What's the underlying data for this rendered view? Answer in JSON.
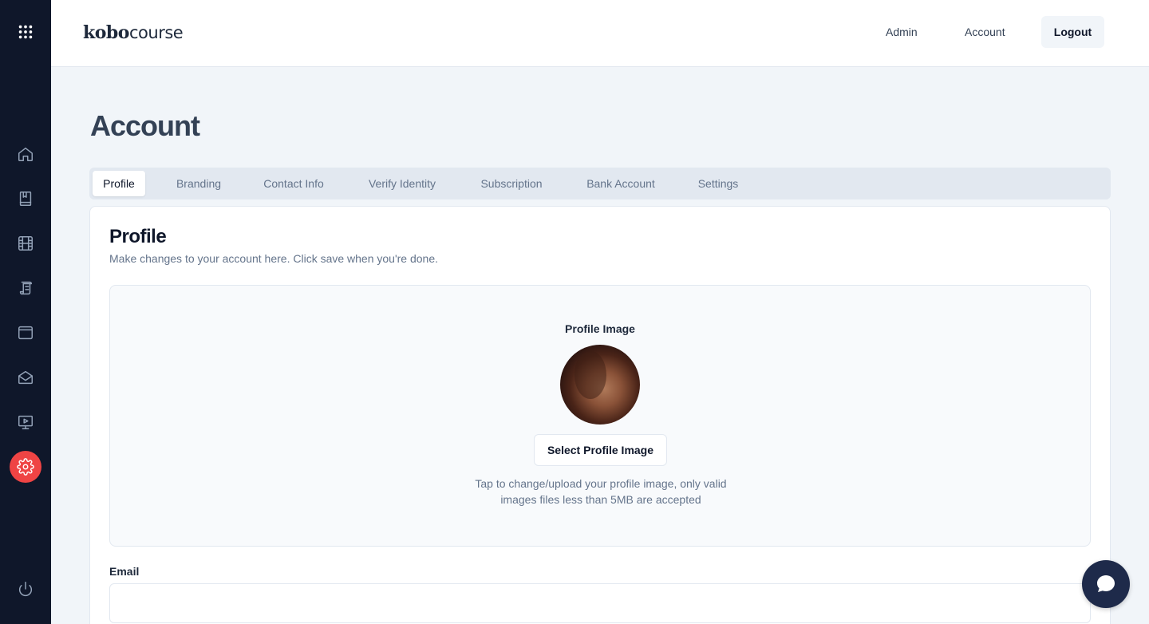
{
  "brand": {
    "logo_bold": "kobo",
    "logo_light": "course"
  },
  "topnav": {
    "admin": "Admin",
    "account": "Account",
    "logout": "Logout"
  },
  "sidebar": {
    "items": [
      {
        "icon": "apps-grid-icon"
      },
      {
        "icon": "home-icon"
      },
      {
        "icon": "book-icon"
      },
      {
        "icon": "film-icon"
      },
      {
        "icon": "scroll-icon"
      },
      {
        "icon": "window-icon"
      },
      {
        "icon": "mail-open-icon"
      },
      {
        "icon": "presentation-play-icon"
      },
      {
        "icon": "gear-icon",
        "active": true
      },
      {
        "icon": "power-icon"
      }
    ],
    "active_color": "#ef4444"
  },
  "page": {
    "title": "Account"
  },
  "tabs": [
    {
      "label": "Profile",
      "active": true
    },
    {
      "label": "Branding"
    },
    {
      "label": "Contact Info"
    },
    {
      "label": "Verify Identity"
    },
    {
      "label": "Subscription"
    },
    {
      "label": "Bank Account"
    },
    {
      "label": "Settings"
    }
  ],
  "profile": {
    "title": "Profile",
    "description": "Make changes to your account here. Click save when you're done.",
    "image_label": "Profile Image",
    "select_button": "Select Profile Image",
    "hint_line1": "Tap to change/upload your profile image, only valid",
    "hint_line2": "images files less than 5MB are accepted",
    "email_label": "Email",
    "email_value": ""
  }
}
